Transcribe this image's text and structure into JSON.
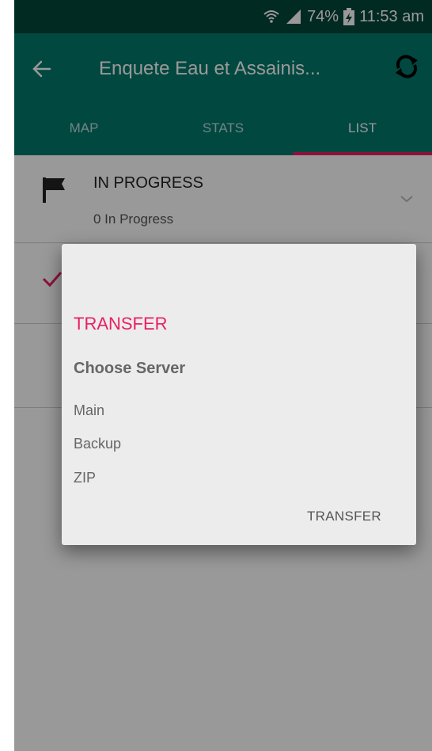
{
  "status_bar": {
    "battery": "74%",
    "time": "11:53 am",
    "icons": [
      "wifi-icon",
      "signal-icon",
      "battery-charging-icon"
    ]
  },
  "toolbar": {
    "back_icon": "arrow-left-icon",
    "title": "Enquete Eau et Assainis...",
    "sync_icon": "sync-icon"
  },
  "tabs": [
    {
      "label": "MAP"
    },
    {
      "label": "STATS"
    },
    {
      "label": "LIST",
      "active": true
    }
  ],
  "list": {
    "sections": [
      {
        "title": "IN PROGRESS",
        "subtitle": "0 In Progress",
        "icon": "flag-icon"
      },
      {
        "title": "",
        "subtitle": "",
        "icon": "check-icon"
      }
    ]
  },
  "dialog": {
    "title": "TRANSFER",
    "subtitle": "Choose Server",
    "options": [
      "Main",
      "Backup",
      "ZIP"
    ],
    "action": "TRANSFER"
  },
  "colors": {
    "primary": "#00796b",
    "primary_dark": "#00473a",
    "accent": "#e91e63"
  }
}
